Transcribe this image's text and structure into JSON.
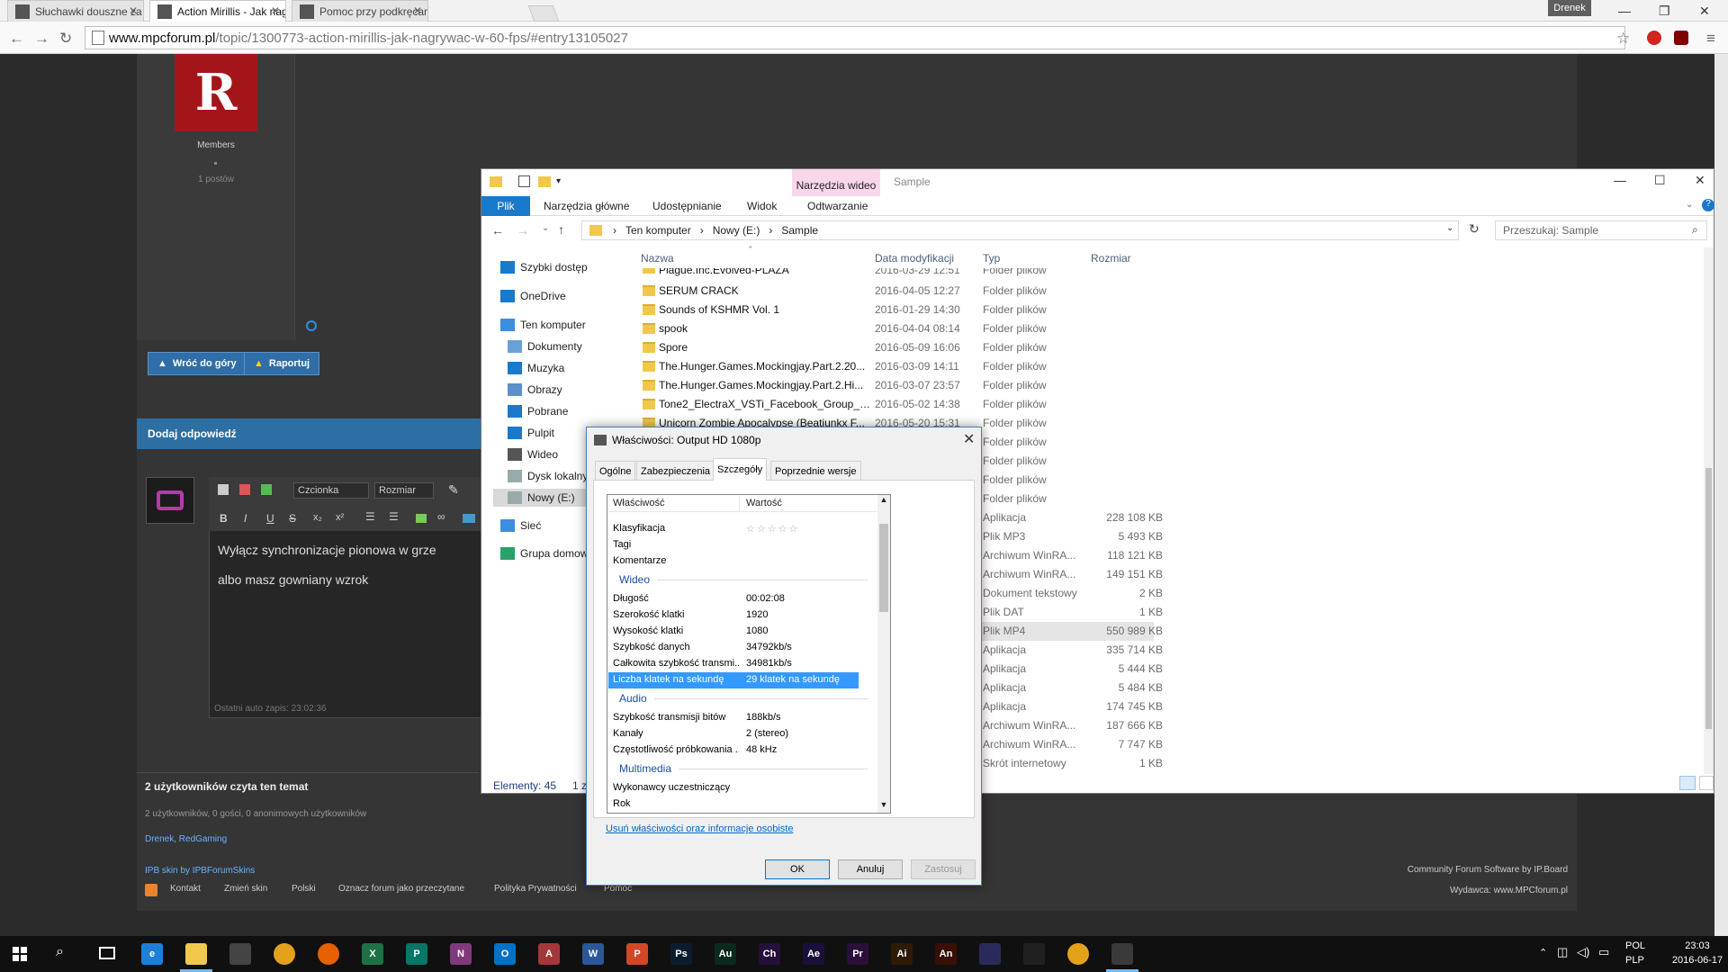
{
  "browser": {
    "tabs": [
      {
        "label": "Słuchawki douszne za oko"
      },
      {
        "label": "Action Mirillis - Jak nagry"
      },
      {
        "label": "Pomoc przy podkręcaniu"
      }
    ],
    "profile": "Drenek",
    "url_host": "www.mpcforum.pl",
    "url_path": "/topic/1300773-action-mirillis-jak-nagrywac-w-60-fps/#entry13105027"
  },
  "forum": {
    "member_group": "Members",
    "post_count": "1 postów",
    "back_to_top": "Wróć do góry",
    "report": "Raportuj",
    "reply_header": "Dodaj odpowiedź",
    "font_label": "Czcionka",
    "size_label": "Rozmiar",
    "reply_line1": "Wyłącz synchronizacje pionowa w grze",
    "reply_line2": "albo masz gowniany wzrok",
    "autosave": "Ostatni auto zapis: 23:02:36",
    "readers_title": "2 użytkowników czyta ten temat",
    "readers_detail": "2 użytkowników, 0 gości, 0 anonimowych użytkowników",
    "readers_names": "Drenek, RedGaming",
    "skin_credit": "IPB skin by IPBForumSkins",
    "footer_links": [
      "Kontakt",
      "Zmień skin",
      "Polski",
      "Oznacz forum jako przeczytane",
      "Polityka Prywatności",
      "Pomoc"
    ],
    "footer_right1": "Community Forum Software by IP.Board",
    "footer_right2": "Wydawca: www.MPCforum.pl"
  },
  "explorer": {
    "context_tab": "Narzędzia wideo",
    "window_title": "Sample",
    "ribbon_tabs": [
      "Plik",
      "Narzędzia główne",
      "Udostępnianie",
      "Widok",
      "Odtwarzanie"
    ],
    "path": [
      "Ten komputer",
      "Nowy (E:)",
      "Sample"
    ],
    "search_placeholder": "Przeszukaj: Sample",
    "nav": [
      {
        "label": "Szybki dostęp",
        "icon": "star-icon"
      },
      {
        "label": "OneDrive",
        "icon": "cloud-icon"
      },
      {
        "label": "Ten komputer",
        "icon": "computer-icon"
      },
      {
        "label": "Dokumenty",
        "icon": "document-icon"
      },
      {
        "label": "Muzyka",
        "icon": "music-icon"
      },
      {
        "label": "Obrazy",
        "icon": "image-icon"
      },
      {
        "label": "Pobrane",
        "icon": "download-icon"
      },
      {
        "label": "Pulpit",
        "icon": "desktop-icon"
      },
      {
        "label": "Wideo",
        "icon": "video-icon"
      },
      {
        "label": "Dysk lokalny",
        "icon": "drive-icon"
      },
      {
        "label": "Nowy (E:)",
        "icon": "drive-icon"
      },
      {
        "label": "Sieć",
        "icon": "network-icon"
      },
      {
        "label": "Grupa domowa",
        "icon": "homegroup-icon"
      }
    ],
    "columns": [
      "Nazwa",
      "Data modyfikacji",
      "Typ",
      "Rozmiar"
    ],
    "files": [
      {
        "name": "Plague.Inc.Evolved-PLAZA",
        "date": "2016-03-29 12:51",
        "type": "Folder plików",
        "size": ""
      },
      {
        "name": "SERUM CRACK",
        "date": "2016-04-05 12:27",
        "type": "Folder plików",
        "size": ""
      },
      {
        "name": "Sounds of KSHMR Vol. 1",
        "date": "2016-01-29 14:30",
        "type": "Folder plików",
        "size": ""
      },
      {
        "name": "spook",
        "date": "2016-04-04 08:14",
        "type": "Folder plików",
        "size": ""
      },
      {
        "name": "Spore",
        "date": "2016-05-09 16:06",
        "type": "Folder plików",
        "size": ""
      },
      {
        "name": "The.Hunger.Games.Mockingjay.Part.2.20...",
        "date": "2016-03-09 14:11",
        "type": "Folder plików",
        "size": ""
      },
      {
        "name": "The.Hunger.Games.Mockingjay.Part.2.Hi...",
        "date": "2016-03-07 23:57",
        "type": "Folder plików",
        "size": ""
      },
      {
        "name": "Tone2_ElectraX_VSTi_Facebook_Group_Pr...",
        "date": "2016-05-02 14:38",
        "type": "Folder plików",
        "size": ""
      },
      {
        "name": "Unicorn Zombie Apocalypse (Beatjunkx F...",
        "date": "2016-05-20 15:31",
        "type": "Folder plików",
        "size": ""
      },
      {
        "name": "",
        "date": "",
        "type": "Folder plików",
        "size": ""
      },
      {
        "name": "",
        "date": "",
        "type": "Folder plików",
        "size": ""
      },
      {
        "name": "",
        "date": "",
        "type": "Folder plików",
        "size": ""
      },
      {
        "name": "",
        "date": "",
        "type": "Folder plików",
        "size": ""
      },
      {
        "name": "",
        "date": "",
        "type": "Aplikacja",
        "size": "228 108 KB"
      },
      {
        "name": "",
        "date": "",
        "type": "Plik MP3",
        "size": "5 493 KB"
      },
      {
        "name": "",
        "date": "",
        "type": "Archiwum WinRA...",
        "size": "118 121 KB"
      },
      {
        "name": "",
        "date": "",
        "type": "Archiwum WinRA...",
        "size": "149 151 KB"
      },
      {
        "name": "",
        "date": "",
        "type": "Dokument tekstowy",
        "size": "2 KB"
      },
      {
        "name": "",
        "date": "",
        "type": "Plik DAT",
        "size": "1 KB"
      },
      {
        "name": "",
        "date": "",
        "type": "Plik MP4",
        "size": "550 989 KB"
      },
      {
        "name": "",
        "date": "",
        "type": "Aplikacja",
        "size": "335 714 KB"
      },
      {
        "name": "",
        "date": "",
        "type": "Aplikacja",
        "size": "5 444 KB"
      },
      {
        "name": "",
        "date": "",
        "type": "Aplikacja",
        "size": "5 484 KB"
      },
      {
        "name": "",
        "date": "",
        "type": "Aplikacja",
        "size": "174 745 KB"
      },
      {
        "name": "",
        "date": "",
        "type": "Archiwum WinRA...",
        "size": "187 666 KB"
      },
      {
        "name": "",
        "date": "",
        "type": "Archiwum WinRA...",
        "size": "7 747 KB"
      },
      {
        "name": "",
        "date": "",
        "type": "Skrót internetowy",
        "size": "1 KB"
      }
    ],
    "status_count": "Elementy: 45",
    "status_extra": "1 z"
  },
  "dialog": {
    "title": "Właściwości: Output HD 1080p",
    "tabs": [
      "Ogólne",
      "Zabezpieczenia",
      "Szczegóły",
      "Poprzednie wersje"
    ],
    "col_property": "Właściwość",
    "col_value": "Wartość",
    "rows_top": [
      {
        "k": "Klasyfikacja",
        "v": "☆☆☆☆☆"
      },
      {
        "k": "Tagi",
        "v": ""
      },
      {
        "k": "Komentarze",
        "v": ""
      }
    ],
    "section_video": "Wideo",
    "rows_video": [
      {
        "k": "Długość",
        "v": "00:02:08"
      },
      {
        "k": "Szerokość klatki",
        "v": "1920"
      },
      {
        "k": "Wysokość klatki",
        "v": "1080"
      },
      {
        "k": "Szybkość danych",
        "v": "34792kb/s"
      },
      {
        "k": "Całkowita szybkość transmi...",
        "v": "34981kb/s"
      },
      {
        "k": "Liczba klatek na sekundę",
        "v": "29 klatek na sekundę"
      }
    ],
    "section_audio": "Audio",
    "rows_audio": [
      {
        "k": "Szybkość transmisji bitów",
        "v": "188kb/s"
      },
      {
        "k": "Kanały",
        "v": "2 (stereo)"
      },
      {
        "k": "Częstotliwość próbkowania ...",
        "v": "48 kHz"
      }
    ],
    "section_multimedia": "Multimedia",
    "rows_multimedia": [
      {
        "k": "Wykonawcy uczestniczący",
        "v": ""
      },
      {
        "k": "Rok",
        "v": ""
      }
    ],
    "remove_link": "Usuń właściwości oraz informacje osobiste",
    "ok": "OK",
    "cancel": "Anuluj",
    "apply": "Zastosuj"
  },
  "taskbar": {
    "apps": [
      {
        "name": "edge-icon",
        "color": "#1e7fd8",
        "glyph": "e"
      },
      {
        "name": "file-explorer-icon",
        "color": "#f1c84b",
        "glyph": ""
      },
      {
        "name": "store-icon",
        "color": "#444444",
        "glyph": ""
      },
      {
        "name": "chrome-icon",
        "color": "#e3a21a",
        "glyph": ""
      },
      {
        "name": "firefox-icon",
        "color": "#e66000",
        "glyph": ""
      },
      {
        "name": "excel-icon",
        "color": "#1e7145",
        "glyph": "X"
      },
      {
        "name": "publisher-icon",
        "color": "#077568",
        "glyph": "P"
      },
      {
        "name": "onenote-icon",
        "color": "#80397b",
        "glyph": "N"
      },
      {
        "name": "outlook-icon",
        "color": "#0072c6",
        "glyph": "O"
      },
      {
        "name": "access-icon",
        "color": "#a4373a",
        "glyph": "A"
      },
      {
        "name": "word-icon",
        "color": "#2b579a",
        "glyph": "W"
      },
      {
        "name": "powerpoint-icon",
        "color": "#d24726",
        "glyph": "P"
      },
      {
        "name": "photoshop-icon",
        "color": "#0b1c2e",
        "glyph": "Ps"
      },
      {
        "name": "audition-icon",
        "color": "#0b2a1e",
        "glyph": "Au"
      },
      {
        "name": "character-animator-icon",
        "color": "#24103a",
        "glyph": "Ch"
      },
      {
        "name": "after-effects-icon",
        "color": "#1a0f3a",
        "glyph": "Ae"
      },
      {
        "name": "premiere-icon",
        "color": "#2a0f3a",
        "glyph": "Pr"
      },
      {
        "name": "illustrator-icon",
        "color": "#2e1a05",
        "glyph": "Ai"
      },
      {
        "name": "animate-icon",
        "color": "#3a0f05",
        "glyph": "An"
      },
      {
        "name": "adobe-app-icon",
        "color": "#2a2a5a",
        "glyph": ""
      },
      {
        "name": "fox-app-icon",
        "color": "#202020",
        "glyph": ""
      },
      {
        "name": "chrome-icon-2",
        "color": "#e3a21a",
        "glyph": ""
      },
      {
        "name": "video-app-icon",
        "color": "#3a3a3a",
        "glyph": ""
      }
    ],
    "lang1": "POL",
    "lang2": "PLP",
    "time": "23:03",
    "date": "2016-06-17"
  }
}
